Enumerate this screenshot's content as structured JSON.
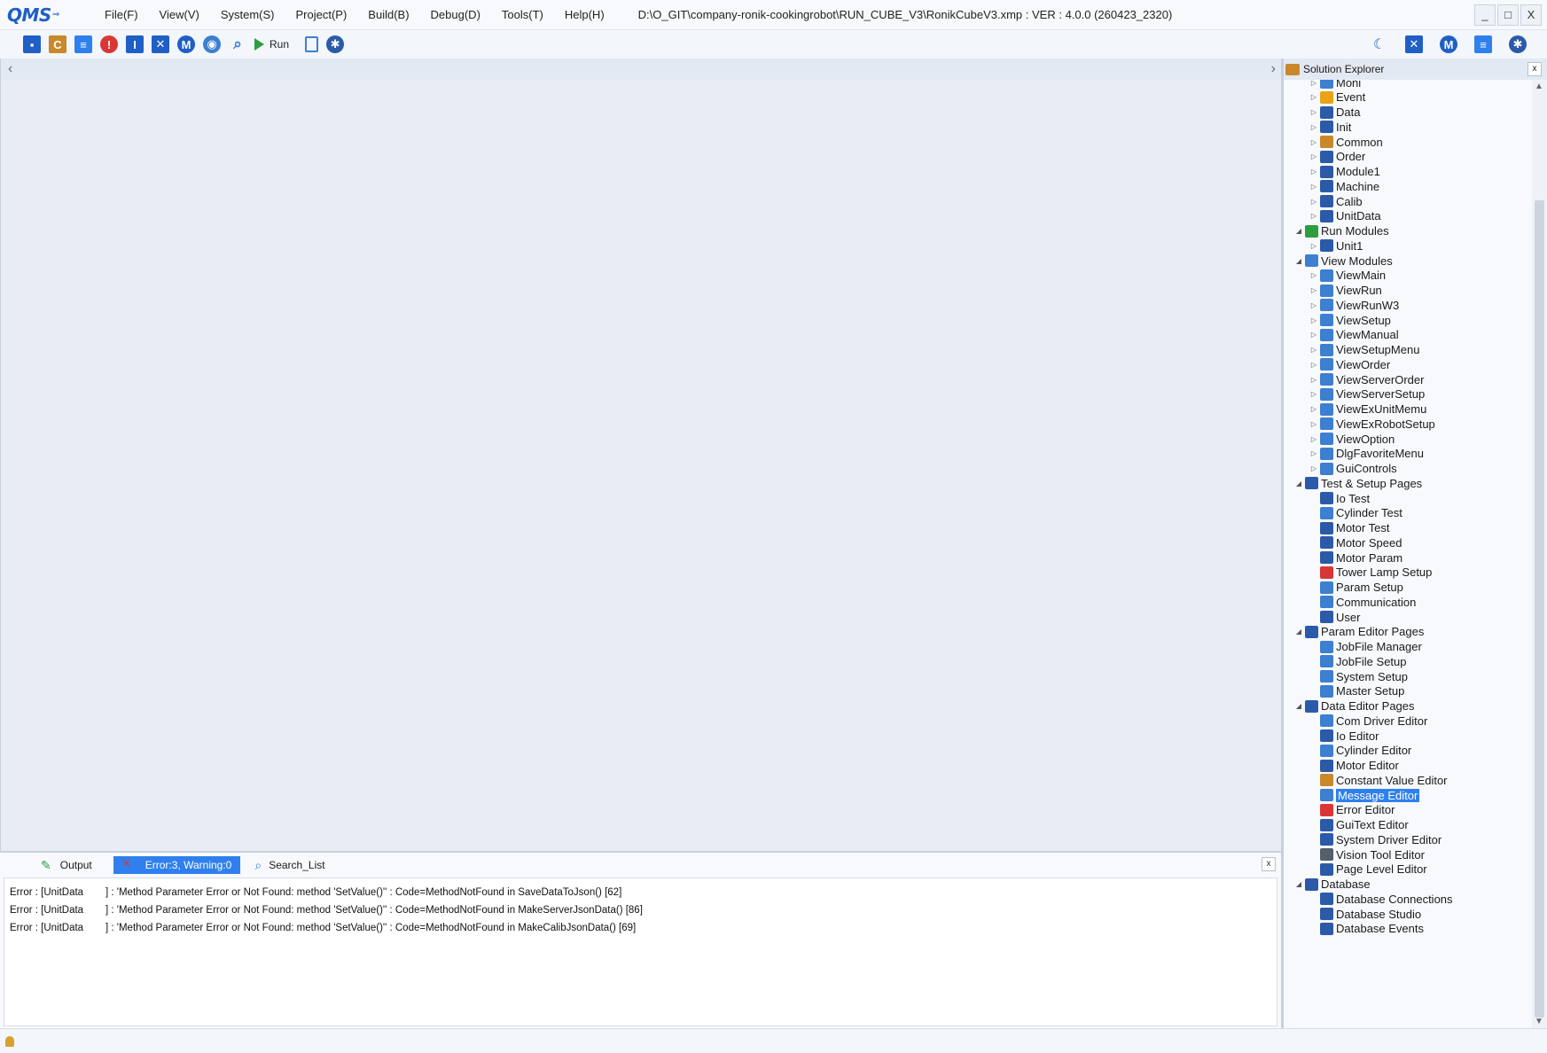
{
  "app": {
    "logo": "QMS",
    "menu": [
      "File(F)",
      "View(V)",
      "System(S)",
      "Project(P)",
      "Build(B)",
      "Debug(D)",
      "Tools(T)",
      "Help(H)"
    ],
    "title_path": "D:\\O_GIT\\company-ronik-cookingrobot\\RUN_CUBE_V3\\RonikCubeV3.xmp :  VER : 4.0.0 (260423_2320)",
    "window_controls": [
      "_",
      "□",
      "X"
    ]
  },
  "toolbar": {
    "buttons": [
      {
        "icon": "save-icon",
        "color": "#1f5fc6",
        "glyph": "▪"
      },
      {
        "icon": "constant-icon",
        "color": "#c9882b",
        "glyph": "C"
      },
      {
        "icon": "message-icon",
        "color": "#2f80ed",
        "glyph": "≡"
      },
      {
        "icon": "error-icon",
        "color": "#d93636",
        "glyph": "!"
      },
      {
        "icon": "guitext-icon",
        "color": "#1f5fc6",
        "glyph": "I"
      },
      {
        "icon": "io-icon",
        "color": "#1f5fc6",
        "glyph": "✕"
      },
      {
        "icon": "motor-icon",
        "color": "#1f5fc6",
        "glyph": "M"
      },
      {
        "icon": "database-icon",
        "color": "#3d7fd1",
        "glyph": "◉"
      },
      {
        "icon": "search-icon",
        "color": "#3d7fd1",
        "glyph": "⌕"
      }
    ],
    "run_label": "Run",
    "right_icons": [
      "theme-moon-icon",
      "io-icon",
      "motor-icon",
      "document-icon",
      "settings-gear-icon"
    ]
  },
  "explorer": {
    "title": "Solution Explorer",
    "close": "x",
    "nodes": [
      {
        "label": "Moni",
        "level": 1,
        "icon_color": "#3d7fd1"
      },
      {
        "label": "Event",
        "level": 1,
        "icon_color": "#e8a317"
      },
      {
        "label": "Data",
        "level": 1,
        "icon_color": "#2b5aa8"
      },
      {
        "label": "Init",
        "level": 1,
        "icon_color": "#2b5aa8"
      },
      {
        "label": "Common",
        "level": 1,
        "icon_color": "#c9882b"
      },
      {
        "label": "Order",
        "level": 1,
        "icon_color": "#2b5aa8"
      },
      {
        "label": "Module1",
        "level": 1,
        "icon_color": "#2b5aa8"
      },
      {
        "label": "Machine",
        "level": 1,
        "icon_color": "#2b5aa8"
      },
      {
        "label": "Calib",
        "level": 1,
        "icon_color": "#2b5aa8"
      },
      {
        "label": "UnitData",
        "level": 1,
        "icon_color": "#2b5aa8"
      },
      {
        "label": "Run Modules",
        "level": 0,
        "icon_color": "#2e9d3e"
      },
      {
        "label": "Unit1",
        "level": 1,
        "icon_color": "#2b5aa8"
      },
      {
        "label": "View Modules",
        "level": 0,
        "icon_color": "#3d7fd1"
      },
      {
        "label": "ViewMain",
        "level": 1,
        "icon_color": "#3d7fd1"
      },
      {
        "label": "ViewRun",
        "level": 1,
        "icon_color": "#3d7fd1"
      },
      {
        "label": "ViewRunW3",
        "level": 1,
        "icon_color": "#3d7fd1"
      },
      {
        "label": "ViewSetup",
        "level": 1,
        "icon_color": "#3d7fd1"
      },
      {
        "label": "ViewManual",
        "level": 1,
        "icon_color": "#3d7fd1"
      },
      {
        "label": "ViewSetupMenu",
        "level": 1,
        "icon_color": "#3d7fd1"
      },
      {
        "label": "ViewOrder",
        "level": 1,
        "icon_color": "#3d7fd1"
      },
      {
        "label": "ViewServerOrder",
        "level": 1,
        "icon_color": "#3d7fd1"
      },
      {
        "label": "ViewServerSetup",
        "level": 1,
        "icon_color": "#3d7fd1"
      },
      {
        "label": "ViewExUnitMemu",
        "level": 1,
        "icon_color": "#3d7fd1"
      },
      {
        "label": "ViewExRobotSetup",
        "level": 1,
        "icon_color": "#3d7fd1"
      },
      {
        "label": "ViewOption",
        "level": 1,
        "icon_color": "#3d7fd1"
      },
      {
        "label": "DlgFavoriteMenu",
        "level": 1,
        "icon_color": "#3d7fd1"
      },
      {
        "label": "GuiControls",
        "level": 1,
        "icon_color": "#3d7fd1"
      },
      {
        "label": "Test & Setup Pages",
        "level": 0,
        "icon_color": "#2b5aa8"
      },
      {
        "label": "Io Test",
        "level": 2,
        "icon_color": "#2b5aa8"
      },
      {
        "label": "Cylinder Test",
        "level": 2,
        "icon_color": "#3d7fd1"
      },
      {
        "label": "Motor Test",
        "level": 2,
        "icon_color": "#2b5aa8"
      },
      {
        "label": "Motor Speed",
        "level": 2,
        "icon_color": "#2b5aa8"
      },
      {
        "label": "Motor Param",
        "level": 2,
        "icon_color": "#2b5aa8"
      },
      {
        "label": "Tower Lamp Setup",
        "level": 2,
        "icon_color": "#d93636"
      },
      {
        "label": "Param Setup",
        "level": 2,
        "icon_color": "#3d7fd1"
      },
      {
        "label": "Communication",
        "level": 2,
        "icon_color": "#3d7fd1"
      },
      {
        "label": "User",
        "level": 2,
        "icon_color": "#2b5aa8"
      },
      {
        "label": "Param Editor Pages",
        "level": 0,
        "icon_color": "#2b5aa8"
      },
      {
        "label": "JobFile Manager",
        "level": 2,
        "icon_color": "#3d7fd1"
      },
      {
        "label": "JobFile Setup",
        "level": 2,
        "icon_color": "#3d7fd1"
      },
      {
        "label": "System Setup",
        "level": 2,
        "icon_color": "#3d7fd1"
      },
      {
        "label": "Master Setup",
        "level": 2,
        "icon_color": "#3d7fd1"
      },
      {
        "label": "Data Editor Pages",
        "level": 0,
        "icon_color": "#2b5aa8"
      },
      {
        "label": "Com Driver Editor",
        "level": 2,
        "icon_color": "#3d7fd1"
      },
      {
        "label": "Io Editor",
        "level": 2,
        "icon_color": "#2b5aa8"
      },
      {
        "label": "Cylinder Editor",
        "level": 2,
        "icon_color": "#3d7fd1"
      },
      {
        "label": "Motor Editor",
        "level": 2,
        "icon_color": "#2b5aa8"
      },
      {
        "label": "Constant Value Editor",
        "level": 2,
        "icon_color": "#c9882b"
      },
      {
        "label": "Message Editor",
        "level": 2,
        "icon_color": "#3d7fd1",
        "selected": true
      },
      {
        "label": "Error Editor",
        "level": 2,
        "icon_color": "#d93636"
      },
      {
        "label": "GuiText Editor",
        "level": 2,
        "icon_color": "#2b5aa8"
      },
      {
        "label": "System Driver Editor",
        "level": 2,
        "icon_color": "#2b5aa8"
      },
      {
        "label": "Vision Tool Editor",
        "level": 2,
        "icon_color": "#555f6b"
      },
      {
        "label": "Page Level Editor",
        "level": 2,
        "icon_color": "#2b5aa8"
      },
      {
        "label": "Database",
        "level": 0,
        "icon_color": "#2b5aa8"
      },
      {
        "label": "Database Connections",
        "level": 2,
        "icon_color": "#2b5aa8"
      },
      {
        "label": "Database Studio",
        "level": 2,
        "icon_color": "#2b5aa8"
      },
      {
        "label": "Database Events",
        "level": 2,
        "icon_color": "#2b5aa8"
      }
    ]
  },
  "output": {
    "tabs": [
      {
        "label": "Output",
        "icon": "pencil-icon"
      },
      {
        "label": "Error:3, Warning:0",
        "icon": "error-icon",
        "active": true
      },
      {
        "label": "Search_List",
        "icon": "search-icon"
      }
    ],
    "close": "x",
    "errors": [
      {
        "source": "Error : [UnitData",
        "message": "] : 'Method Parameter Error or Not Found: method 'SetValue()'' : Code=MethodNotFound    in SaveDataToJson() [62]"
      },
      {
        "source": "Error : [UnitData",
        "message": "] : 'Method Parameter Error or Not Found: method 'SetValue()'' : Code=MethodNotFound    in MakeServerJsonData() [86]"
      },
      {
        "source": "Error : [UnitData",
        "message": "] : 'Method Parameter Error or Not Found: method 'SetValue()'' : Code=MethodNotFound    in MakeCalibJsonData() [69]"
      }
    ]
  },
  "editor": {
    "left_chevron": "‹",
    "right_chevron": "›"
  }
}
